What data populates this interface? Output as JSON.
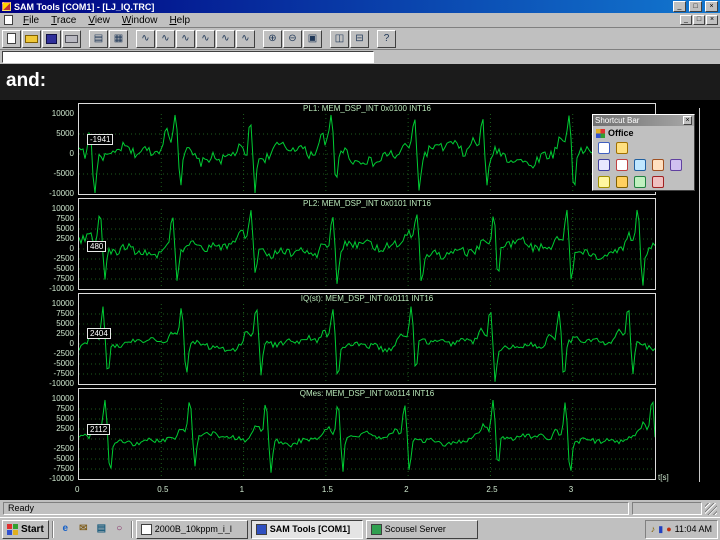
{
  "titlebar": {
    "title": "SAM Tools [COM1] - [LJ_IQ.TRC]",
    "minimize": "_",
    "maximize": "□",
    "close": "×"
  },
  "menubar": {
    "items": [
      "File",
      "Trace",
      "View",
      "Window",
      "Help"
    ],
    "minimize": "_",
    "restore": "□",
    "close": "×"
  },
  "toolbar": {
    "buttons": [
      {
        "name": "new-icon",
        "css": "i-new"
      },
      {
        "name": "open-icon",
        "css": "i-open"
      },
      {
        "name": "save-icon",
        "css": "i-save"
      },
      {
        "name": "print-icon",
        "css": "i-print"
      },
      {
        "sep": true
      },
      {
        "name": "trace-setup-icon",
        "glyph": "▤"
      },
      {
        "name": "trace-config-icon",
        "glyph": "▦"
      },
      {
        "sep": true
      },
      {
        "name": "trace-1-icon",
        "glyph": "∿"
      },
      {
        "name": "trace-2-icon",
        "glyph": "∿"
      },
      {
        "name": "trace-3-icon",
        "glyph": "∿"
      },
      {
        "name": "trace-4-icon",
        "glyph": "∿"
      },
      {
        "name": "trace-5-icon",
        "glyph": "∿"
      },
      {
        "name": "trace-6-icon",
        "glyph": "∿"
      },
      {
        "sep": true
      },
      {
        "name": "zoom-in-icon",
        "glyph": "⊕"
      },
      {
        "name": "zoom-out-icon",
        "glyph": "⊖"
      },
      {
        "name": "zoom-reset-icon",
        "glyph": "▣"
      },
      {
        "sep": true
      },
      {
        "name": "cascade-windows-icon",
        "glyph": "◫"
      },
      {
        "name": "tile-windows-icon",
        "glyph": "⊟"
      },
      {
        "sep": true
      },
      {
        "name": "help-icon",
        "glyph": "?"
      }
    ]
  },
  "trace_input": {
    "value": ""
  },
  "caption": {
    "text": "and:"
  },
  "chart": {
    "type": "line",
    "x_axis_label": "t[s]",
    "x_range": [
      0,
      3.5
    ],
    "trace_color": "#00cc33",
    "grid_color": "#1d5c1d",
    "x_ticks": [
      {
        "t": 0,
        "label": "0"
      },
      {
        "t": 0.5,
        "label": "0.5"
      },
      {
        "t": 1,
        "label": "1"
      },
      {
        "t": 1.5,
        "label": "1.5"
      },
      {
        "t": 2,
        "label": "2"
      },
      {
        "t": 2.5,
        "label": "2.5"
      },
      {
        "t": 3,
        "label": "3"
      }
    ],
    "panels": [
      {
        "title": "PL1: MEM_DSP_INT 0x0100 INT16",
        "marker_value": "-1941",
        "ylim": [
          -10000,
          10000
        ],
        "y_ticks": [
          "10000",
          "5000",
          "0",
          "-5000",
          "-10000"
        ]
      },
      {
        "title": "PL2: MEM_DSP_INT 0x0101 INT16",
        "marker_value": "480",
        "ylim": [
          -10000,
          10000
        ],
        "y_ticks": [
          "10000",
          "7500",
          "5000",
          "2500",
          "0",
          "-2500",
          "-5000",
          "-7500",
          "-10000"
        ]
      },
      {
        "title": "IQ(st): MEM_DSP_INT 0x0111 INT16",
        "marker_value": "2404",
        "ylim": [
          -10000,
          10000
        ],
        "y_ticks": [
          "10000",
          "7500",
          "5000",
          "2500",
          "0",
          "-2500",
          "-5000",
          "-7500",
          "-10000"
        ]
      },
      {
        "title": "QMes: MEM_DSP_INT 0x0114 INT16",
        "marker_value": "2112",
        "ylim": [
          -10000,
          10000
        ],
        "y_ticks": [
          "10000",
          "7500",
          "5000",
          "2500",
          "0",
          "-2500",
          "-5000",
          "-7500",
          "-10000"
        ]
      }
    ]
  },
  "shortcut_bar": {
    "title": "Shortcut Bar",
    "close": "×",
    "section_label": "Office",
    "rows": [
      [
        {
          "name": "new-office-document-icon",
          "color": "#ffffff",
          "border": "#4060c0"
        },
        {
          "name": "open-office-document-icon",
          "color": "#ffe080",
          "border": "#a07000"
        }
      ],
      [
        {
          "name": "new-message-icon",
          "color": "#e8e8ff",
          "border": "#4040a0"
        },
        {
          "name": "new-appointment-icon",
          "color": "#ffffff",
          "border": "#c04040"
        },
        {
          "name": "new-task-icon",
          "color": "#c0e8ff",
          "border": "#2060a0"
        },
        {
          "name": "new-contact-icon",
          "color": "#ffe0c0",
          "border": "#a05020"
        },
        {
          "name": "new-journal-icon",
          "color": "#d0c0f0",
          "border": "#6040a0"
        }
      ],
      [
        {
          "name": "new-note-icon",
          "color": "#fff7a0",
          "border": "#a09000"
        },
        {
          "name": "outlook-icon",
          "color": "#ffd060",
          "border": "#806000"
        },
        {
          "name": "getting-results-icon",
          "color": "#c0f0c0",
          "border": "#208040"
        },
        {
          "name": "office-help-icon",
          "color": "#f0c0c0",
          "border": "#a02020"
        }
      ]
    ]
  },
  "statusbar": {
    "text": "Ready"
  },
  "taskbar": {
    "start_label": "Start",
    "quick_launch": [
      {
        "name": "internet-explorer-icon",
        "glyph": "e",
        "color": "#1560c8"
      },
      {
        "name": "outlook-express-icon",
        "glyph": "✉",
        "color": "#806020"
      },
      {
        "name": "show-desktop-icon",
        "glyph": "▤",
        "color": "#206080"
      },
      {
        "name": "channels-icon",
        "glyph": "○",
        "color": "#802060"
      }
    ],
    "tasks": [
      {
        "label": "2000B_10kppm_i_l",
        "active": false,
        "icon_color": "#ffffff"
      },
      {
        "label": "SAM Tools [COM1]",
        "active": true,
        "icon_color": "#3050c0"
      },
      {
        "label": "Scousel Server",
        "active": false,
        "icon_color": "#30a050"
      }
    ],
    "tray_icons": [
      {
        "name": "volume-icon",
        "glyph": "♪",
        "color": "#806000"
      },
      {
        "name": "modem-icon",
        "glyph": "▮",
        "color": "#2040c0"
      },
      {
        "name": "scheduler-icon",
        "glyph": "●",
        "color": "#c03010"
      }
    ],
    "clock": "11:04 AM"
  }
}
